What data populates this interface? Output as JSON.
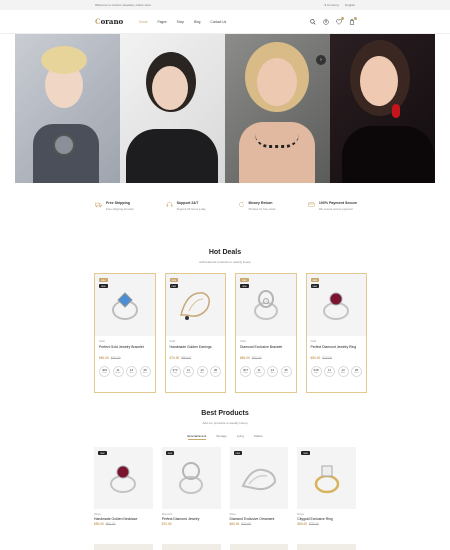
{
  "topbar": {
    "welcome": "Welcome to Corano Jewellery online store",
    "currency": "$ Currency",
    "language": "English"
  },
  "header": {
    "logo_main": "C",
    "logo_rest": "orano",
    "nav": [
      "Home",
      "Pages",
      "Shop",
      "Blog",
      "Contact Us"
    ]
  },
  "features": [
    {
      "title": "Free Shipping",
      "sub": "Free shipping all order"
    },
    {
      "title": "Support 24/7",
      "sub": "Support 24 hours a day"
    },
    {
      "title": "Money Return",
      "sub": "30 days for free return"
    },
    {
      "title": "100% Payment Secure",
      "sub": "We ensure secure payment"
    }
  ],
  "hot_deals": {
    "title": "Hot Deals",
    "subtitle": "Add featured products to weekly lineup",
    "items": [
      {
        "tag1": "sale",
        "tag2": "new",
        "category": "Gold",
        "name": "Perfect Gold Jewelry Bracelet",
        "price": "$60.00",
        "old": "$70.00",
        "days": "409",
        "hours": "11",
        "mins": "13",
        "secs": "35"
      },
      {
        "tag1": "sale",
        "tag2": "new",
        "category": "Gold",
        "name": "Handmade Golden Earrings",
        "price": "$70.00",
        "old": "$80.00",
        "days": "373",
        "hours": "11",
        "mins": "13",
        "secs": "35"
      },
      {
        "tag1": "sale",
        "tag2": "new",
        "category": "Gold",
        "name": "Diamond Exclusive Bracelet",
        "price": "$60.00",
        "old": "$70.00",
        "days": "307",
        "hours": "11",
        "mins": "13",
        "secs": "35"
      },
      {
        "tag1": "sale",
        "tag2": "new",
        "category": "Gold",
        "name": "Perfect Diamond Jewelry Ring",
        "price": "$50.00",
        "old": "$70.00",
        "days": "338",
        "hours": "11",
        "mins": "13",
        "secs": "35"
      }
    ],
    "labels": {
      "days": "Days",
      "hours": "Hours",
      "mins": "Mins",
      "secs": "Secs"
    }
  },
  "best": {
    "title": "Best Products",
    "subtitle": "Add our products to weekly lineup",
    "tabs": [
      "Entertainment",
      "Storage",
      "Lying",
      "Tables"
    ],
    "items": [
      {
        "tag": "new",
        "category": "Rings",
        "name": "Handmade Golden Necklace",
        "price": "$50.00",
        "old": "$60.00"
      },
      {
        "tag": "new",
        "category": "Diamond",
        "name": "Perfect Diamond Jewelry",
        "price": "$70.00",
        "old": ""
      },
      {
        "tag": "new",
        "category": "Silver",
        "name": "Diamond Exclusive Ornament",
        "price": "$60.00",
        "old": "$70.00"
      },
      {
        "tag": "new",
        "category": "Rings",
        "name": "Citygold Exclusive Ring",
        "price": "$60.00",
        "old": "$70.00"
      }
    ]
  },
  "colors": {
    "accent": "#c9a66b"
  }
}
